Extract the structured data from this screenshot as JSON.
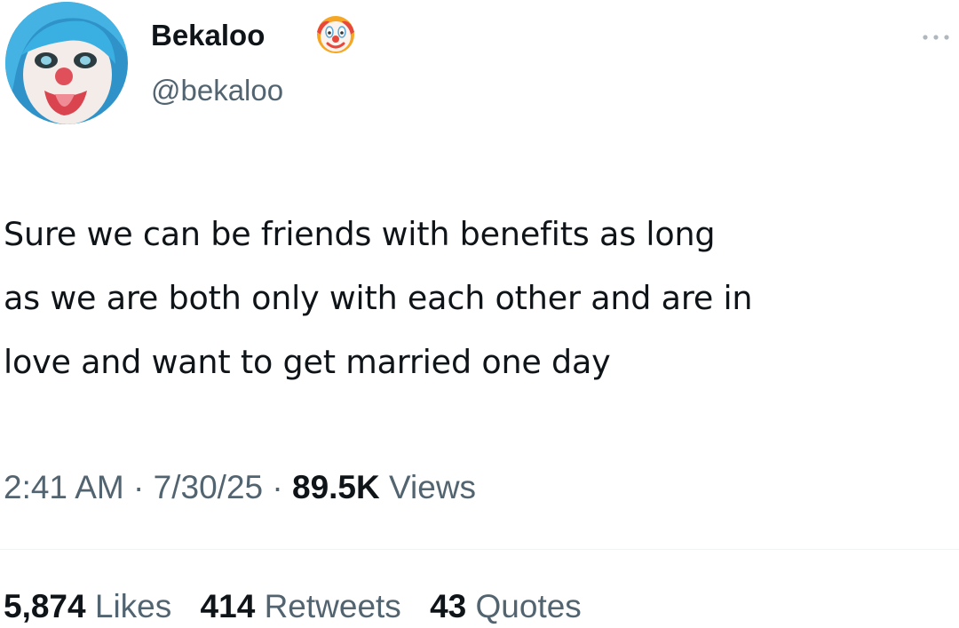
{
  "author": {
    "display_name": "Bekaloo",
    "badge_icon": "clown-face-icon",
    "handle": "@bekaloo",
    "avatar_icon": "profile-avatar"
  },
  "menu": {
    "icon": "more-options-icon"
  },
  "tweet": {
    "text": "Sure we can be friends with benefits as long\nas we are both only with each other and are in\nlove and want to get married one day"
  },
  "meta": {
    "time": "2:41 AM",
    "separator": "·",
    "date": "7/30/25",
    "views_count": "89.5K",
    "views_label": "Views"
  },
  "stats": {
    "likes_count": "5,874",
    "likes_label": "Likes",
    "retweets_count": "414",
    "retweets_label": "Retweets",
    "quotes_count": "43",
    "quotes_label": "Quotes"
  },
  "colors": {
    "text_primary": "#0f1419",
    "text_secondary": "#536471",
    "avatar_hair": "#3aa6d8",
    "clown_nose": "#e0505a"
  }
}
